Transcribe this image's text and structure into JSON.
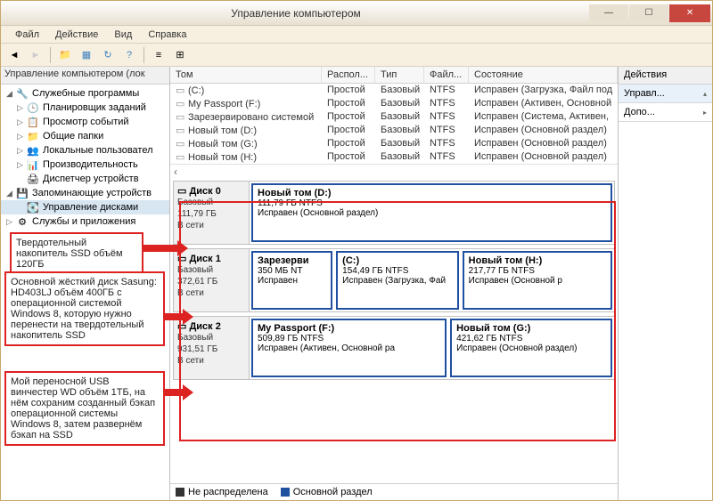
{
  "window": {
    "title": "Управление компьютером"
  },
  "menu": {
    "file": "Файл",
    "action": "Действие",
    "view": "Вид",
    "help": "Справка"
  },
  "tree": {
    "header": "Управление компьютером (лок",
    "root": "Служебные программы",
    "items": [
      "Планировщик заданий",
      "Просмотр событий",
      "Общие папки",
      "Локальные пользовател",
      "Производительность",
      "Диспетчер устройств"
    ],
    "storage": "Запоминающие устройств",
    "diskmgmt": "Управление дисками",
    "services": "Службы и приложения"
  },
  "columns": {
    "volume": "Том",
    "layout": "Распол...",
    "type2": "Тип",
    "fs": "Файл...",
    "status": "Состояние"
  },
  "volumes": [
    {
      "name": "(C:)",
      "layout": "Простой",
      "type": "Базовый",
      "fs": "NTFS",
      "status": "Исправен (Загрузка, Файл под"
    },
    {
      "name": "My Passport (F:)",
      "layout": "Простой",
      "type": "Базовый",
      "fs": "NTFS",
      "status": "Исправен (Активен, Основной"
    },
    {
      "name": "Зарезервировано системой",
      "layout": "Простой",
      "type": "Базовый",
      "fs": "NTFS",
      "status": "Исправен (Система, Активен,"
    },
    {
      "name": "Новый том (D:)",
      "layout": "Простой",
      "type": "Базовый",
      "fs": "NTFS",
      "status": "Исправен (Основной раздел)"
    },
    {
      "name": "Новый том (G:)",
      "layout": "Простой",
      "type": "Базовый",
      "fs": "NTFS",
      "status": "Исправен (Основной раздел)"
    },
    {
      "name": "Новый том (H:)",
      "layout": "Простой",
      "type": "Базовый",
      "fs": "NTFS",
      "status": "Исправен (Основной раздел)"
    }
  ],
  "disks": [
    {
      "label": "Диск 0",
      "type": "Базовый",
      "size": "111,79 ГБ",
      "status": "В сети",
      "parts": [
        {
          "title": "Новый том  (D:)",
          "size": "111,79 ГБ NTFS",
          "status": "Исправен (Основной раздел)",
          "flex": 1
        }
      ]
    },
    {
      "label": "Диск 1",
      "type": "Базовый",
      "size": "372,61 ГБ",
      "status": "В сети",
      "parts": [
        {
          "title": "Зарезерви",
          "size": "350 МБ NT",
          "status": "Исправен",
          "flex": 0.25
        },
        {
          "title": "(C:)",
          "size": "154,49 ГБ NTFS",
          "status": "Исправен (Загрузка, Фай",
          "flex": 0.4
        },
        {
          "title": "Новый том  (H:)",
          "size": "217,77 ГБ NTFS",
          "status": "Исправен (Основной р",
          "flex": 0.5
        }
      ]
    },
    {
      "label": "Диск 2",
      "type": "Базовый",
      "size": "931,51 ГБ",
      "status": "В сети",
      "parts": [
        {
          "title": "My Passport  (F:)",
          "size": "509,89 ГБ NTFS",
          "status": "Исправен (Активен, Основной ра",
          "flex": 0.55
        },
        {
          "title": "Новый том  (G:)",
          "size": "421,62 ГБ NTFS",
          "status": "Исправен (Основной раздел)",
          "flex": 0.45
        }
      ]
    }
  ],
  "legend": {
    "unalloc": "Не распределена",
    "primary": "Основной раздел"
  },
  "actions": {
    "header": "Действия",
    "main": "Управл...",
    "more": "Допо..."
  },
  "callouts": {
    "ssd": "Твердотельный накопитель SSD объём 120ГБ",
    "hdd": "Основной жёсткий диск Sasung: HD403LJ объём 400ГБ с операционной системой Windows 8, которую нужно перенести на твердотельный накопитель SSD",
    "usb": "Мой переносной USB винчестер WD объём 1ТБ, на нём сохраним созданный бэкап операционной системы Windows 8, затем развернём бэкап на SSD"
  }
}
